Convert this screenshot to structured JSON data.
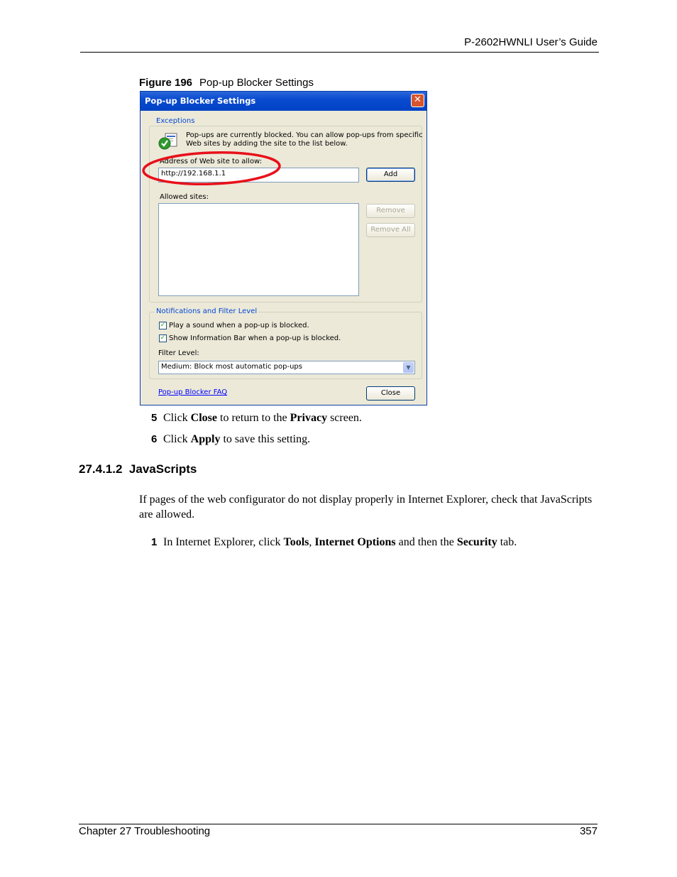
{
  "header": {
    "title": "P-2602HWNLI User’s Guide"
  },
  "figure": {
    "label": "Figure 196",
    "title": "Pop-up Blocker Settings"
  },
  "dialog": {
    "title": "Pop-up Blocker Settings",
    "close_glyph": "✕",
    "exceptions": {
      "legend": "Exceptions",
      "info_line1": "Pop-ups are currently blocked.  You can allow pop-ups from specific",
      "info_line2": "Web sites by adding the site to the list below.",
      "address_label": "Address of Web site to allow:",
      "address_value": "http://192.168.1.1",
      "add_button": "Add",
      "allowed_label": "Allowed sites:",
      "remove_button": "Remove",
      "remove_all_button": "Remove All"
    },
    "notifications": {
      "legend": "Notifications and Filter Level",
      "play_sound_label": "Play a sound when a pop-up is blocked.",
      "play_sound_checked": true,
      "show_infobar_label": "Show Information Bar when a pop-up is blocked.",
      "show_infobar_checked": true,
      "filter_label": "Filter Level:",
      "filter_value": "Medium: Block most automatic pop-ups"
    },
    "faq_link": "Pop-up Blocker FAQ",
    "close_button": "Close",
    "highlight_color": "#e8101a",
    "title_color": "#0a4bd0"
  },
  "steps": [
    {
      "num": "5",
      "pre": "Click ",
      "b1": "Close",
      "mid": " to return to the ",
      "b2": "Privacy",
      "post": " screen."
    },
    {
      "num": "6",
      "pre": "Click ",
      "b1": "Apply",
      "post": " to save this setting."
    }
  ],
  "section": {
    "number": "27.4.1.2",
    "title": "JavaScripts",
    "paragraph": "If pages of the web configurator do not display properly in Internet Explorer, check that JavaScripts are allowed."
  },
  "step1": {
    "num": "1",
    "pre": "In Internet Explorer, click ",
    "b1": "Tools",
    "sep": ", ",
    "b2": "Internet Options",
    "mid": " and then the ",
    "b3": "Security",
    "post": " tab."
  },
  "footer": {
    "chapter": "Chapter 27 Troubleshooting",
    "page": "357"
  }
}
